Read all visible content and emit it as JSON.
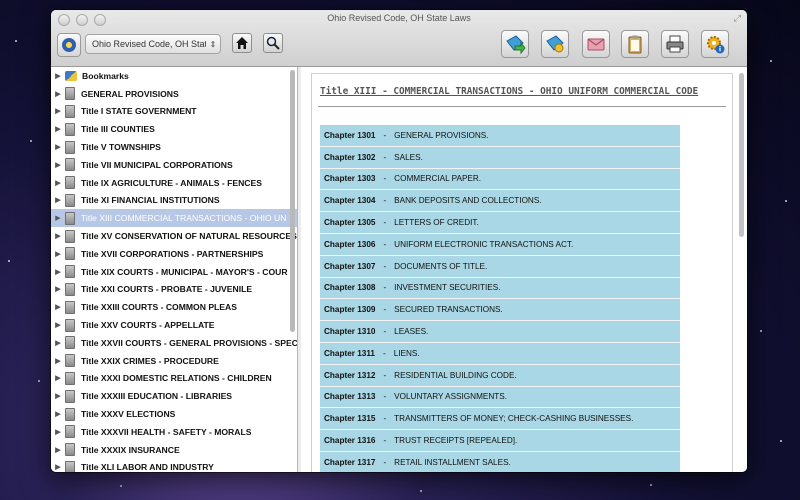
{
  "window": {
    "title": "Ohio Revised Code, OH State Laws"
  },
  "toolbar": {
    "dropdown_value": "Ohio Revised Code, OH State Laws",
    "home_icon": "home-icon",
    "search_icon": "magnifier-icon",
    "right_icons": [
      "bookmark-add-icon",
      "bookmark-tag-icon",
      "mail-icon",
      "clipboard-icon",
      "printer-icon",
      "settings-info-icon"
    ]
  },
  "sidebar": {
    "items": [
      {
        "label": "Bookmarks",
        "type": "bookmarks"
      },
      {
        "label": "GENERAL PROVISIONS"
      },
      {
        "label": "Title I  STATE GOVERNMENT"
      },
      {
        "label": "Title III  COUNTIES"
      },
      {
        "label": "Title V  TOWNSHIPS"
      },
      {
        "label": "Title VII  MUNICIPAL CORPORATIONS"
      },
      {
        "label": "Title IX  AGRICULTURE - ANIMALS - FENCES"
      },
      {
        "label": "Title XI  FINANCIAL INSTITUTIONS"
      },
      {
        "label": "Title XIII  COMMERCIAL TRANSACTIONS - OHIO UN",
        "selected": true
      },
      {
        "label": "Title XV  CONSERVATION OF NATURAL RESOURCES"
      },
      {
        "label": "Title XVII  CORPORATIONS - PARTNERSHIPS"
      },
      {
        "label": "Title XIX  COURTS - MUNICIPAL - MAYOR'S - COUR"
      },
      {
        "label": "Title XXI  COURTS - PROBATE - JUVENILE"
      },
      {
        "label": "Title XXIII  COURTS - COMMON PLEAS"
      },
      {
        "label": "Title XXV  COURTS - APPELLATE"
      },
      {
        "label": "Title XXVII  COURTS - GENERAL PROVISIONS - SPEC"
      },
      {
        "label": "Title XXIX  CRIMES - PROCEDURE"
      },
      {
        "label": "Title XXXI  DOMESTIC RELATIONS - CHILDREN"
      },
      {
        "label": "Title XXXIII  EDUCATION - LIBRARIES"
      },
      {
        "label": "Title XXXV  ELECTIONS"
      },
      {
        "label": "Title XXXVII  HEALTH - SAFETY - MORALS"
      },
      {
        "label": "Title XXXIX  INSURANCE"
      },
      {
        "label": "Title XLI  LABOR AND INDUSTRY"
      }
    ]
  },
  "main": {
    "title": "Title XIII - COMMERCIAL TRANSACTIONS - OHIO UNIFORM COMMERCIAL CODE",
    "separator": "-",
    "chapters": [
      {
        "num": "Chapter 1301",
        "name": "GENERAL PROVISIONS."
      },
      {
        "num": "Chapter 1302",
        "name": "SALES."
      },
      {
        "num": "Chapter 1303",
        "name": "COMMERCIAL PAPER."
      },
      {
        "num": "Chapter 1304",
        "name": "BANK DEPOSITS AND COLLECTIONS."
      },
      {
        "num": "Chapter 1305",
        "name": "LETTERS OF CREDIT."
      },
      {
        "num": "Chapter 1306",
        "name": "UNIFORM ELECTRONIC TRANSACTIONS ACT."
      },
      {
        "num": "Chapter 1307",
        "name": "DOCUMENTS OF TITLE."
      },
      {
        "num": "Chapter 1308",
        "name": "INVESTMENT SECURITIES."
      },
      {
        "num": "Chapter 1309",
        "name": "SECURED TRANSACTIONS."
      },
      {
        "num": "Chapter 1310",
        "name": "LEASES."
      },
      {
        "num": "Chapter 1311",
        "name": "LIENS."
      },
      {
        "num": "Chapter 1312",
        "name": "RESIDENTIAL BUILDING CODE."
      },
      {
        "num": "Chapter 1313",
        "name": "VOLUNTARY ASSIGNMENTS."
      },
      {
        "num": "Chapter 1315",
        "name": "TRANSMITTERS OF MONEY; CHECK-CASHING BUSINESSES."
      },
      {
        "num": "Chapter 1316",
        "name": "TRUST RECEIPTS [REPEALED]."
      },
      {
        "num": "Chapter 1317",
        "name": "RETAIL INSTALLMENT SALES."
      }
    ]
  }
}
